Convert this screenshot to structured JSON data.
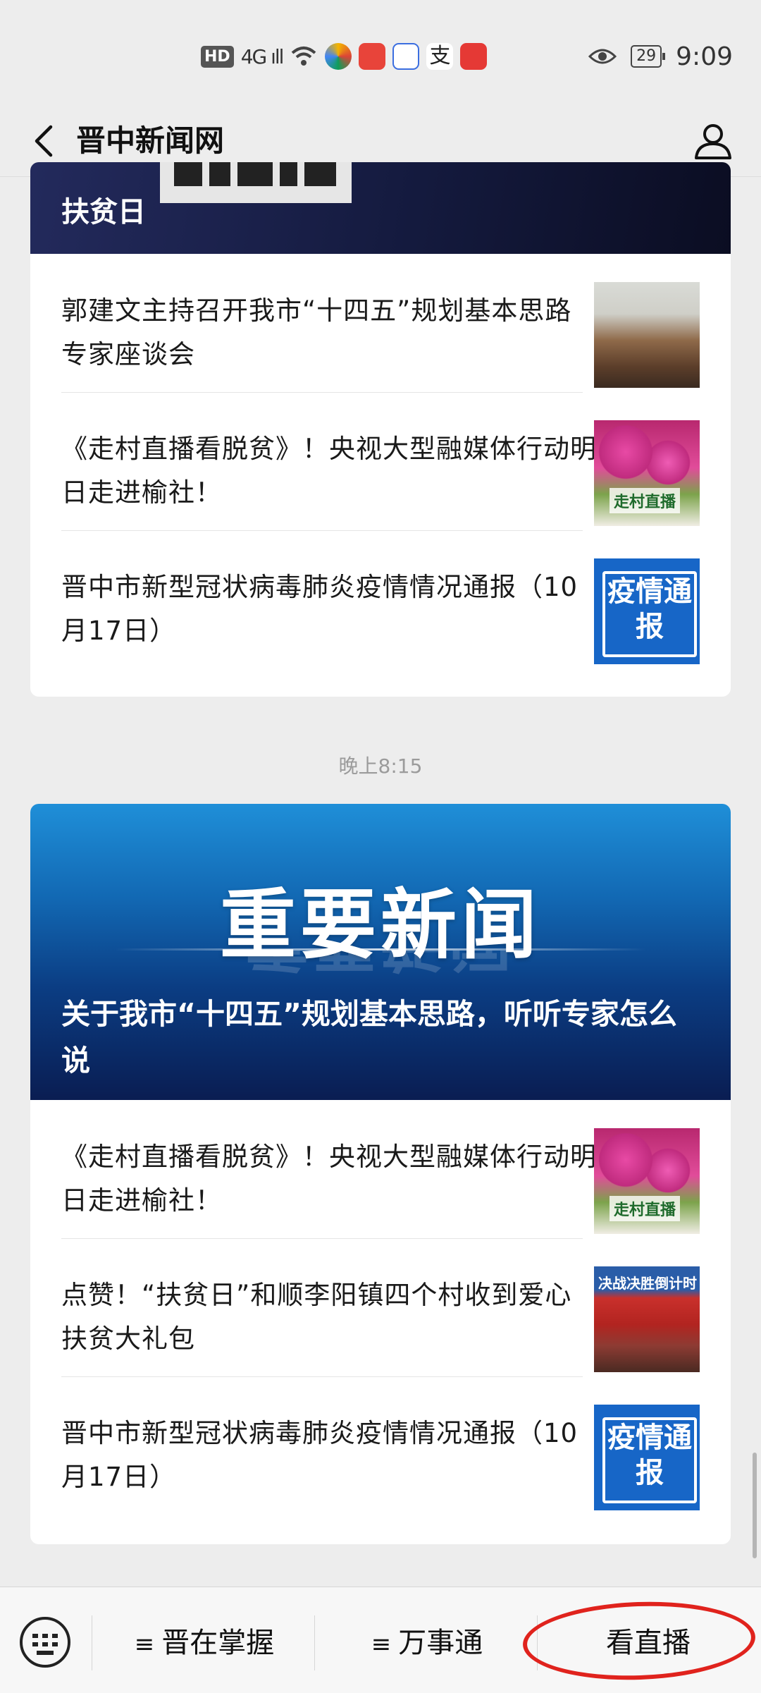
{
  "status_bar": {
    "hd": "HD",
    "signal": "4G ıll",
    "apps": [
      {
        "name": "wifi-icon",
        "color": "#444444"
      },
      {
        "name": "colorful-app-icon",
        "color": "#3aa0e8"
      },
      {
        "name": "shopping-app-icon",
        "color": "#e8443a"
      },
      {
        "name": "baidu-app-icon",
        "color": "#3b6ee0"
      },
      {
        "name": "alipay-app-icon",
        "color": "#1e88e5"
      },
      {
        "name": "huawei-app-icon",
        "color": "#e53935"
      }
    ],
    "battery": "29",
    "time": "9:09"
  },
  "header": {
    "title": "晋中新闻网"
  },
  "card1": {
    "hero_title": "扶贫日",
    "items": [
      {
        "title": "郭建文主持召开我市“十四五”规划基本思路专家座谈会"
      },
      {
        "title": "《走村直播看脱贫》！央视大型融媒体行动明日走进榆社！",
        "thumb_label": "走村直播"
      },
      {
        "title": "晋中市新型冠状病毒肺炎疫情情况通报（10月17日）",
        "thumb_label": "疫情通报"
      }
    ]
  },
  "timestamp": "晚上8:15",
  "card2": {
    "hero_big": "重要新闻",
    "hero_title": "关于我市“十四五”规划基本思路，听听专家怎么说",
    "items": [
      {
        "title": "《走村直播看脱贫》！央视大型融媒体行动明日走进榆社！",
        "thumb_label": "走村直播"
      },
      {
        "title": "点赞！“扶贫日”和顺李阳镇四个村收到爱心扶贫大礼包",
        "thumb_label": "决战决胜倒计时"
      },
      {
        "title": "晋中市新型冠状病毒肺炎疫情情况通报（10月17日）",
        "thumb_label": "疫情通报"
      }
    ]
  },
  "bottom_bar": {
    "menu1": "晋在掌握",
    "menu2": "万事通",
    "menu3": "看直播",
    "menu_lines": "≡"
  }
}
